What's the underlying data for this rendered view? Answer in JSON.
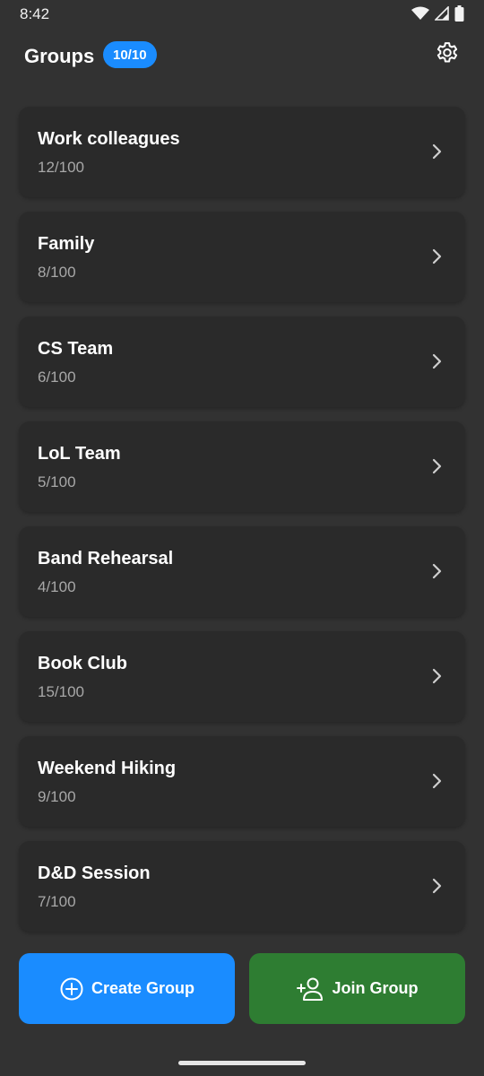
{
  "status_bar": {
    "time": "8:42",
    "icons": [
      "wifi-icon",
      "signal-icon",
      "battery-icon"
    ]
  },
  "header": {
    "title": "Groups",
    "badge": "10/10",
    "settings_icon": "gear-icon"
  },
  "groups": [
    {
      "name": "Work colleagues",
      "count": "12/100"
    },
    {
      "name": "Family",
      "count": "8/100"
    },
    {
      "name": "CS Team",
      "count": "6/100"
    },
    {
      "name": "LoL Team",
      "count": "5/100"
    },
    {
      "name": "Band Rehearsal",
      "count": "4/100"
    },
    {
      "name": "Book Club",
      "count": "15/100"
    },
    {
      "name": "Weekend Hiking",
      "count": "9/100"
    },
    {
      "name": "D&D Session",
      "count": "7/100"
    }
  ],
  "actions": {
    "create_label": "Create Group",
    "join_label": "Join Group"
  },
  "colors": {
    "background": "#323232",
    "card": "#2a2a2a",
    "accent_blue": "#1a8cff",
    "accent_green": "#2e7d32",
    "muted_text": "#a8a8a8"
  }
}
